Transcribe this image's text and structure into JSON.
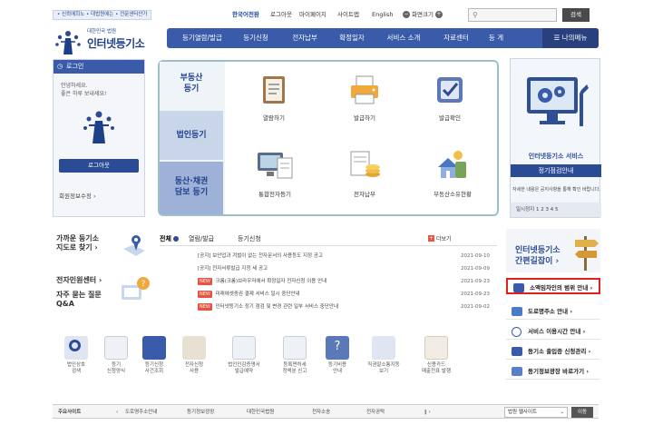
{
  "util": {
    "breadcrumb": "• 신뢰에희노 • 대법원에는 • 전문센터안가",
    "links": [
      "한국어전환",
      "로그아웃",
      "마이페이지",
      "사이트맵",
      "English",
      "화면크기"
    ],
    "search_button": "검색"
  },
  "logo": {
    "sub": "대한민국 법원",
    "main": "인터넷등기소"
  },
  "nav": {
    "items": [
      "등기열람/발급",
      "등기신청",
      "전자납부",
      "확정일자",
      "서비스 소개",
      "자료센터",
      "등 게"
    ],
    "my_menu": "나의메뉴"
  },
  "login": {
    "title": "로그인",
    "greeting": [
      "안녕하세요.",
      "좋은 하루 보내세요!"
    ],
    "logout": "로그아웃",
    "privacy": "회원정보수정 ›"
  },
  "services": {
    "sides": [
      "부동산\n등기",
      "법인등기",
      "동산·채권\n담보 등기"
    ],
    "items": [
      "열람하기",
      "발급하기",
      "발급확인",
      "통합전자등기",
      "전자납부",
      "부동산소유현황"
    ]
  },
  "banner": {
    "title": "인터넷등기소 서비스",
    "subtitle": "정기점검안내",
    "note": "자세한 내용은 공지사항을 통해 확인 바랍니다.",
    "pager": "일시정지  1  2  3  4  5"
  },
  "find": {
    "office": [
      "가까운 등기소",
      "지도로 찾기 ›"
    ],
    "help": [
      "전자민원센터 ›",
      "자주 묻는 질문",
      "Q&A"
    ]
  },
  "news": {
    "tabs": [
      "전체",
      "열람/발급",
      "등기신청"
    ],
    "more": "더보기",
    "rows": [
      {
        "badge": "",
        "text": "[공지] 보안업과 겨벌이 없는 전자문서의 사용등도 지정 공고",
        "date": "2021-09-10"
      },
      {
        "badge": "",
        "text": "[공지] 전자서류발급 지정 세 공고",
        "date": "2021-09-09"
      },
      {
        "badge": "NEW",
        "text": "크롬(크롬)브라우저에서 확정일자 전자신청 이용 안내",
        "date": "2021-09-23"
      },
      {
        "badge": "NEW",
        "text": "미래에셋증권 결제 서비스 일시 중단안내",
        "date": "2021-09-23"
      },
      {
        "badge": "NEW",
        "text": "인터넷등기소 정기 점검 및 변경 관련 일부 서비스 중단안내",
        "date": "2021-09-02"
      }
    ]
  },
  "guide": {
    "title": [
      "인터넷등기소",
      "간편길잡이 ›"
    ],
    "items": [
      "소액임차인의 범위 안내 ›",
      "도로명주소 안내 ›",
      "서비스 이용시간 안내 ›",
      "등기소 출입증 신청관리 ›",
      "등기정보광장 바로가기 ›"
    ]
  },
  "bottom_icons": [
    "법인상호\n검색",
    "등기\n신청양식",
    "등기신청\n사건조회",
    "전자신청\n사용",
    "법인인감증명서\n발급예약",
    "등록면허세\n정액분 신고",
    "등기비용\n안내",
    "직권말소통지등\n보기",
    "신용카드\n매출전표 발행"
  ],
  "footer": {
    "label": "주요사이트",
    "links": [
      "도로명주소안내",
      "등기정보광장",
      "대한민국법원",
      "전자소송",
      "전자공탁"
    ],
    "select": "법원 웹사이트",
    "go": "이동"
  },
  "colors": {
    "primary": "#3a5ba9",
    "dark_primary": "#2b4c94",
    "highlight": "#e02020",
    "teal_border": "#9fbfc8"
  }
}
